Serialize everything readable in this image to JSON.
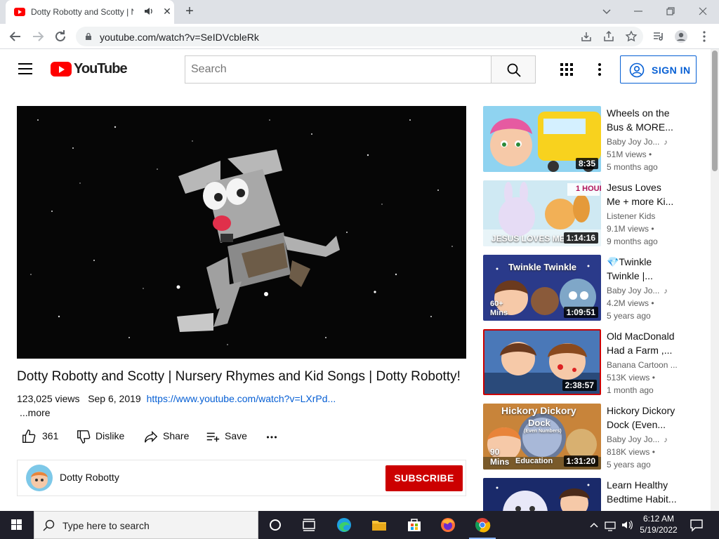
{
  "browser": {
    "tab_title": "Dotty Robotty and Scotty | Nursery Rhymes",
    "new_tab_label": "+",
    "close_label": "✕",
    "url": "youtube.com/watch?v=SeIDVcbleRk"
  },
  "youtube": {
    "logo_text": "YouTube",
    "search_placeholder": "Search",
    "signin_label": "SIGN IN",
    "brand_color": "#ff0000",
    "accent_color": "#065fd4"
  },
  "video": {
    "title": "Dotty Robotty and Scotty | Nursery Rhymes and Kid Songs | Dotty Robotty!",
    "views": "123,025 views",
    "date": "Sep 6, 2019",
    "link": "https://www.youtube.com/watch?v=LXrPd...",
    "more_label": "...more",
    "actions": {
      "likes": "361",
      "dislike": "Dislike",
      "share": "Share",
      "save": "Save"
    },
    "channel": "Dotty Robotty",
    "subscribe_label": "SUBSCRIBE"
  },
  "related": [
    {
      "title_line1": "Wheels on the",
      "title_line2": "Bus & MORE...",
      "channel": "Baby Joy Jo...",
      "music": true,
      "views": "51M views •",
      "age": "5 months ago",
      "duration": "8:35"
    },
    {
      "title_line1": "Jesus Loves",
      "title_line2": "Me + more Ki...",
      "channel": "Listener Kids",
      "music": false,
      "views": "9.1M views •",
      "age": "9 months ago",
      "duration": "1:14:16",
      "badge": "1 HOUR",
      "caption": "JESUS LOVES ME"
    },
    {
      "title_line1": "💎Twinkle",
      "title_line2": "Twinkle |...",
      "channel": "Baby Joy Jo...",
      "music": true,
      "views": "4.2M views •",
      "age": "5 years ago",
      "duration": "1:09:51",
      "caption": "Twinkle Twinkle",
      "badge": "60+ Mins"
    },
    {
      "title_line1": "Old MacDonald",
      "title_line2": "Had a Farm ,...",
      "channel": "Banana Cartoon ...",
      "music": false,
      "views": "513K views •",
      "age": "1 month ago",
      "duration": "2:38:57"
    },
    {
      "title_line1": "Hickory Dickory",
      "title_line2": "Dock (Even...",
      "channel": "Baby Joy Jo...",
      "music": true,
      "views": "818K views •",
      "age": "5 years ago",
      "duration": "1:31:20",
      "caption": "Hickory Dickory",
      "caption2": "Dock",
      "caption3": "(Even Numbers)",
      "badge": "90 Mins",
      "badge2": "Education"
    },
    {
      "title_line1": "Learn Healthy",
      "title_line2": "Bedtime Habit..."
    }
  ],
  "taskbar": {
    "search_placeholder": "Type here to search",
    "time": "6:12 AM",
    "date": "5/19/2022"
  }
}
